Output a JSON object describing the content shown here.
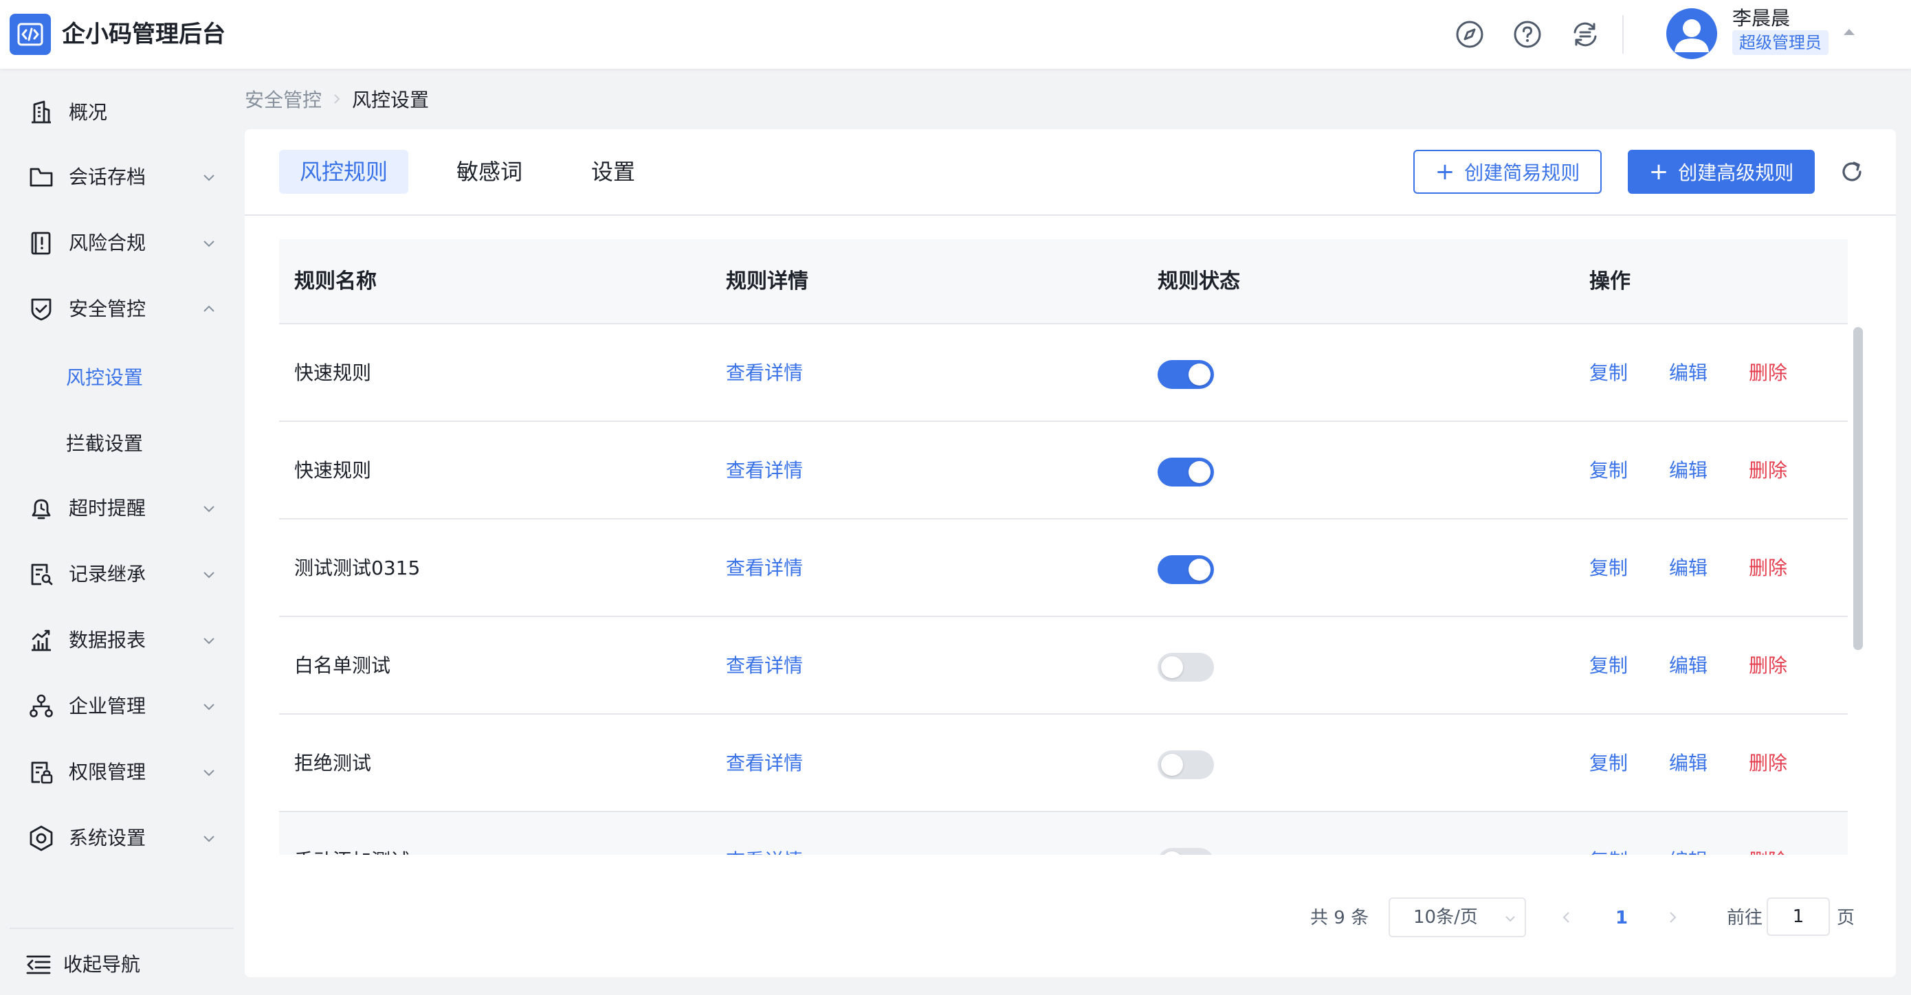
{
  "app": {
    "title": "企小码管理后台"
  },
  "user": {
    "name": "李晨晨",
    "role": "超级管理员"
  },
  "colors": {
    "accent": "#3a73e8",
    "danger": "#e53e4f",
    "toggle_off": "#dfe2e7"
  },
  "header_icons": [
    "compass-icon",
    "help-icon",
    "switch-icon"
  ],
  "sidebar": {
    "items": [
      {
        "label": "概况",
        "icon": "building-icon"
      },
      {
        "label": "会话存档",
        "icon": "folder-icon"
      },
      {
        "label": "风险合规",
        "icon": "alert-book-icon"
      },
      {
        "label": "安全管控",
        "icon": "shield-check-icon"
      },
      {
        "label": "超时提醒",
        "icon": "bell-clock-icon"
      },
      {
        "label": "记录继承",
        "icon": "record-icon"
      },
      {
        "label": "数据报表",
        "icon": "chart-icon"
      },
      {
        "label": "企业管理",
        "icon": "org-icon"
      },
      {
        "label": "权限管理",
        "icon": "permission-icon"
      },
      {
        "label": "系统设置",
        "icon": "settings-hex-icon"
      }
    ],
    "sub_items": [
      {
        "label": "风控设置",
        "active": true
      },
      {
        "label": "拦截设置",
        "active": false
      }
    ],
    "collapse_label": "收起导航"
  },
  "breadcrumb": {
    "parent": "安全管控",
    "current": "风控设置"
  },
  "tabs": [
    {
      "label": "风控规则",
      "active": true
    },
    {
      "label": "敏感词",
      "active": false
    },
    {
      "label": "设置",
      "active": false
    }
  ],
  "buttons": {
    "create_simple": "创建简易规则",
    "create_advanced": "创建高级规则"
  },
  "table": {
    "columns": [
      "规则名称",
      "规则详情",
      "规则状态",
      "操作"
    ],
    "rows": [
      {
        "name": "快速规则",
        "detail": "查看详情",
        "enabled": true,
        "copy": "复制",
        "edit": "编辑",
        "delete": "删除"
      },
      {
        "name": "快速规则",
        "detail": "查看详情",
        "enabled": true,
        "copy": "复制",
        "edit": "编辑",
        "delete": "删除"
      },
      {
        "name": "测试测试0315",
        "detail": "查看详情",
        "enabled": true,
        "copy": "复制",
        "edit": "编辑",
        "delete": "删除"
      },
      {
        "name": "白名单测试",
        "detail": "查看详情",
        "enabled": false,
        "copy": "复制",
        "edit": "编辑",
        "delete": "删除"
      },
      {
        "name": "拒绝测试",
        "detail": "查看详情",
        "enabled": false,
        "copy": "复制",
        "edit": "编辑",
        "delete": "删除"
      },
      {
        "name": "手动添加测试",
        "detail": "查看详情",
        "enabled": false,
        "copy": "复制",
        "edit": "编辑",
        "delete": "删除"
      }
    ]
  },
  "pagination": {
    "total": "共 9 条",
    "page_size": "10条/页",
    "current_page": "1",
    "goto_label": "前往",
    "goto_value": "1",
    "page_suffix": "页"
  }
}
